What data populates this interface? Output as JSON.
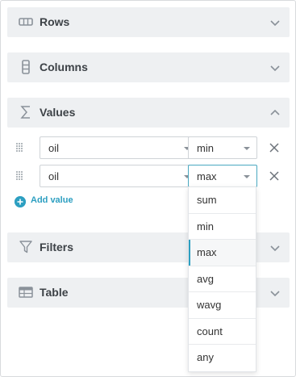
{
  "sections": {
    "rows": {
      "label": "Rows",
      "icon": "rows-icon",
      "expanded": false
    },
    "columns": {
      "label": "Columns",
      "icon": "columns-icon",
      "expanded": false
    },
    "values": {
      "label": "Values",
      "icon": "sigma-icon",
      "expanded": true
    },
    "filters": {
      "label": "Filters",
      "icon": "funnel-icon",
      "expanded": false
    },
    "table": {
      "label": "Table",
      "icon": "table-icon",
      "expanded": false
    }
  },
  "values": {
    "items": [
      {
        "field": "oil",
        "aggregation": "min"
      },
      {
        "field": "oil",
        "aggregation": "max"
      }
    ],
    "add_label": "Add value"
  },
  "aggregation_dropdown": {
    "options": [
      "sum",
      "min",
      "max",
      "avg",
      "wavg",
      "count",
      "any"
    ],
    "selected": "max"
  },
  "colors": {
    "accent": "#2d9fc1",
    "section_bg": "#eef0f2"
  }
}
